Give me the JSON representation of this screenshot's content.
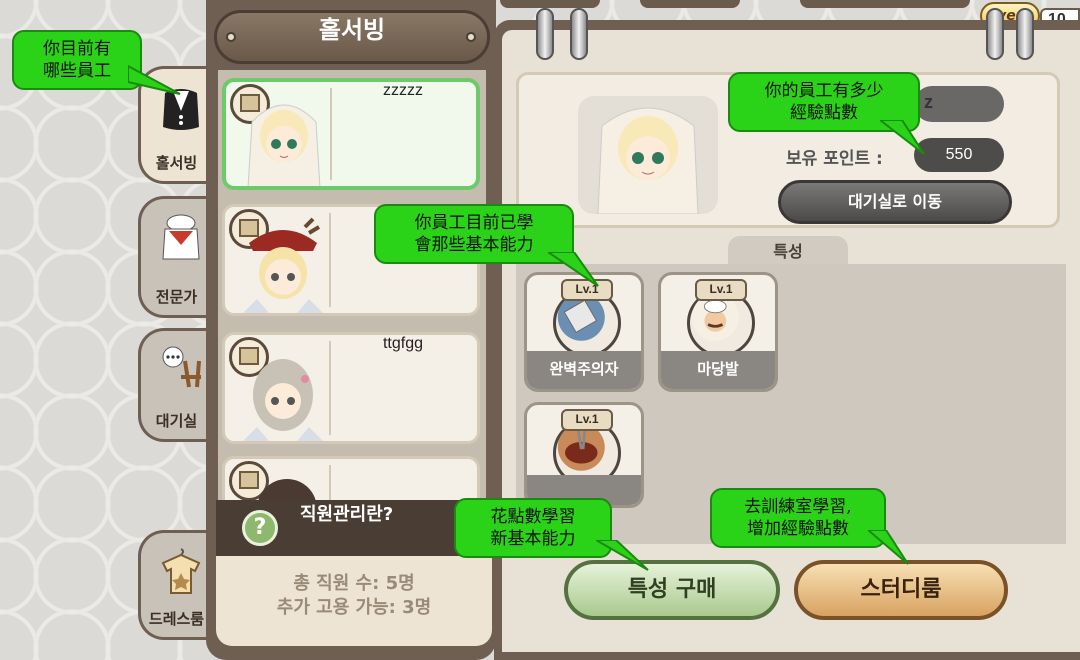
{
  "top": {
    "event_label": "event",
    "counter": "10"
  },
  "tabs": [
    {
      "label": "홀서빙",
      "icon": "server-uniform-icon",
      "active": true
    },
    {
      "label": "전문가",
      "icon": "chef-uniform-icon",
      "active": false
    },
    {
      "label": "대기실",
      "icon": "chair-chat-icon",
      "active": false
    },
    {
      "label": "드레스룸",
      "icon": "dress-hanger-icon",
      "active": false
    }
  ],
  "list": {
    "title": "홀서빙",
    "employees": [
      {
        "name": "zzzzz",
        "selected": true
      },
      {
        "name": "",
        "selected": false
      },
      {
        "name": "ttgfgg",
        "selected": false
      },
      {
        "name": "",
        "selected": false
      }
    ],
    "help_label": "직원관리란?",
    "help_icon": "?",
    "total_staff": "총 직원 수: 5명",
    "extra_hire": "추가 고용 가능: 3명"
  },
  "detail": {
    "points_label": "보유 포인트 :",
    "points_value": "550",
    "partial_name_value": "z",
    "move_button": "대기실로 이동",
    "traits_tab": "특성",
    "traits": [
      {
        "level": "Lv.1",
        "name": "완벽주의자",
        "icon": "ruler-icon"
      },
      {
        "level": "Lv.1",
        "name": "마당발",
        "icon": "chefs-group-icon"
      },
      {
        "level": "Lv.1",
        "name": "",
        "icon": "spaghetti-icon"
      }
    ],
    "buy_button": "특성 구매",
    "study_button": "스터디룸"
  },
  "callouts": {
    "c1": [
      "你目前有",
      "哪些員工"
    ],
    "c2": [
      "你的員工有多少",
      "經驗點數"
    ],
    "c3": [
      "你員工目前已學",
      "會那些基本能力"
    ],
    "c4": [
      "花點數學習",
      "新基本能力"
    ],
    "c5": [
      "去訓練室學習,",
      "增加經驗點數"
    ]
  },
  "colors": {
    "callout_green": "#2bd318",
    "selected_border": "#6ec96a",
    "panel_brown": "#6e5f52"
  }
}
